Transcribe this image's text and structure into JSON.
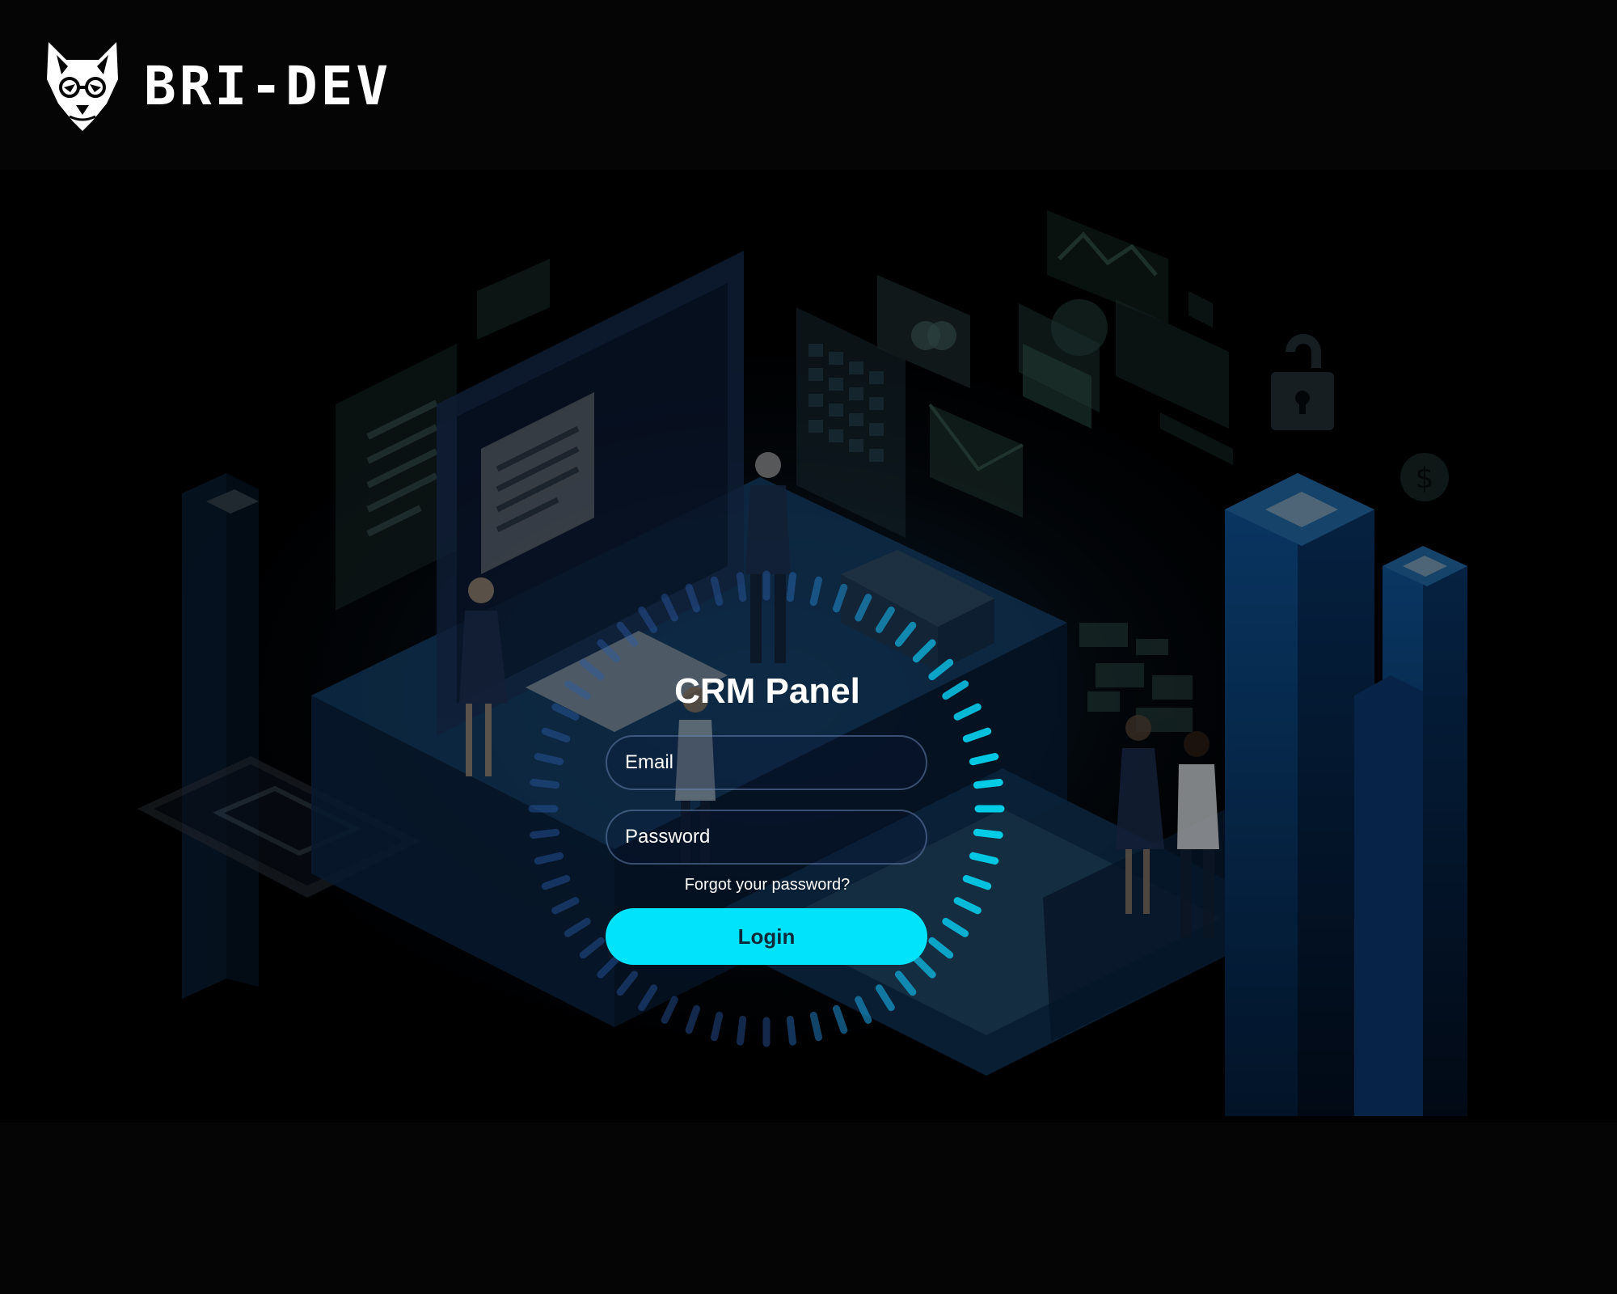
{
  "brand": {
    "name": "BRI-DEV",
    "logo_icon": "wolf-head-icon"
  },
  "hero": {
    "illustration": "isometric-office-city-illustration",
    "colors": {
      "background": "#000000",
      "platform": "#0b2a4a",
      "tower": "#0a3a6a",
      "accent": "#00e3fb"
    }
  },
  "login": {
    "title": "CRM Panel",
    "email_placeholder": "Email",
    "password_placeholder": "Password",
    "forgot_label": "Forgot your password?",
    "login_label": "Login",
    "ring_icon": "loading-ring-icon"
  },
  "colors": {
    "topbar_bg": "#060506",
    "button_bg": "#00e3fb",
    "ring_start": "#2a5aa6",
    "ring_end": "#00d8f0"
  }
}
